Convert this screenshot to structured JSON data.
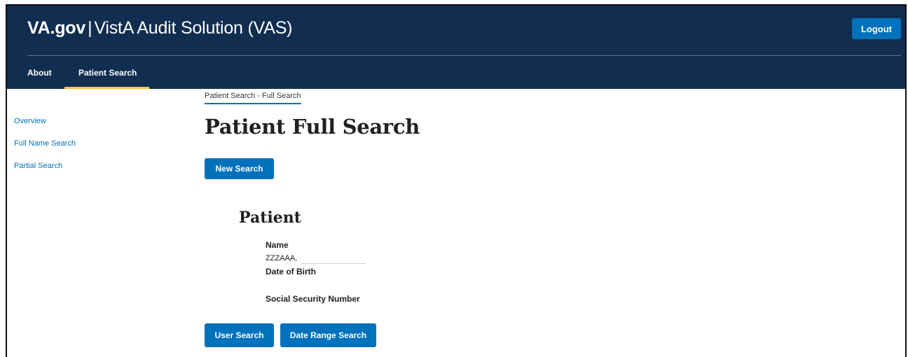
{
  "header": {
    "brand_short": "VA.gov",
    "brand_separator": "|",
    "app_title": "VistA Audit Solution (VAS)",
    "logout_label": "Logout"
  },
  "nav": {
    "items": [
      {
        "label": "About",
        "active": false
      },
      {
        "label": "Patient Search",
        "active": true
      }
    ]
  },
  "sidebar": {
    "items": [
      {
        "label": "Overview"
      },
      {
        "label": "Full Name Search"
      },
      {
        "label": "Partial Search"
      }
    ]
  },
  "breadcrumb": "Patient Search - Full Search",
  "page_title": "Patient Full Search",
  "new_search_label": "New Search",
  "patient": {
    "section_title": "Patient",
    "name_label": "Name",
    "name_value": "ZZZAAA,",
    "dob_label": "Date of Birth",
    "dob_value": "",
    "ssn_label": "Social Security Number",
    "ssn_value": ""
  },
  "actions": {
    "user_search_label": "User Search",
    "date_range_search_label": "Date Range Search"
  },
  "colors": {
    "header_bg": "#112e51",
    "primary_button": "#0071bb",
    "active_tab_underline": "#f9c642",
    "link": "#0071bb"
  }
}
